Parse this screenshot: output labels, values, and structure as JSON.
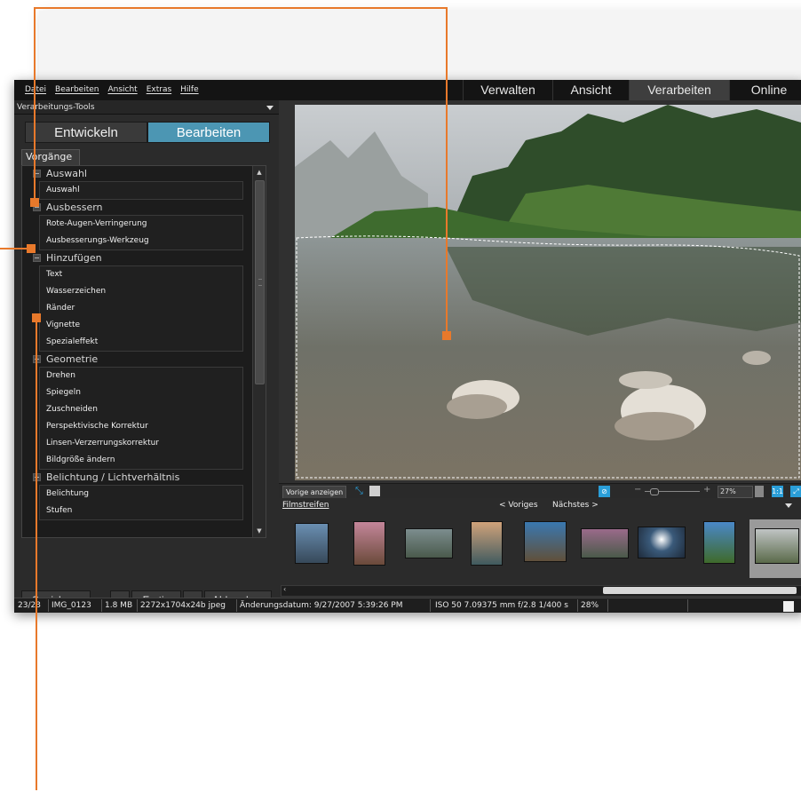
{
  "menu": [
    "Datei",
    "Bearbeiten",
    "Ansicht",
    "Extras",
    "Hilfe"
  ],
  "modes": [
    {
      "label": "Verwalten",
      "active": false
    },
    {
      "label": "Ansicht",
      "active": false
    },
    {
      "label": "Verarbeiten",
      "active": true
    },
    {
      "label": "Online",
      "active": false
    }
  ],
  "panel": {
    "header": "Verarbeitungs-Tools",
    "tabs": [
      "Entwickeln",
      "Bearbeiten"
    ],
    "active_tab": "Bearbeiten",
    "subtab": "Vorgänge",
    "groups": [
      {
        "title": "Auswahl",
        "items": [
          "Auswahl"
        ]
      },
      {
        "title": "Ausbessern",
        "items": [
          "Rote-Augen-Verringerung",
          "Ausbesserungs-Werkzeug"
        ]
      },
      {
        "title": "Hinzufügen",
        "items": [
          "Text",
          "Wasserzeichen",
          "Ränder",
          "Vignette",
          "Spezialeffekt"
        ]
      },
      {
        "title": "Geometrie",
        "items": [
          "Drehen",
          "Spiegeln",
          "Zuschneiden",
          "Perspektivische Korrektur",
          "Linsen-Verzerrungskorrektur",
          "Bildgröße ändern"
        ]
      },
      {
        "title": "Belichtung / Lichtverhältnis",
        "items": [
          "Belichtung",
          "Stufen"
        ]
      }
    ],
    "buttons": {
      "save": "Speichern",
      "prev": "<",
      "done": "Fertig",
      "next": ">",
      "cancel": "Abbrechen"
    }
  },
  "viewer": {
    "show_previous": "Vorige anzeigen",
    "zoom_value": "27%",
    "one_to_one": "1:1"
  },
  "filmstrip": {
    "title": "Filmstreifen",
    "prev": "< Voriges",
    "next": "Nächstes >"
  },
  "status": {
    "position": "23/23",
    "filename": "IMG_0123",
    "size": "1.8 MB",
    "dims": "2272x1704x24b jpeg",
    "date": "Änderungsdatum: 9/27/2007 5:39:26 PM",
    "exif": "ISO 50  7.09375 mm  f/2.8  1/400 s",
    "zoom": "28%"
  },
  "colors": {
    "accent": "#4c96b3",
    "callout": "#e8792b",
    "icon_blue": "#2a9ed8"
  }
}
